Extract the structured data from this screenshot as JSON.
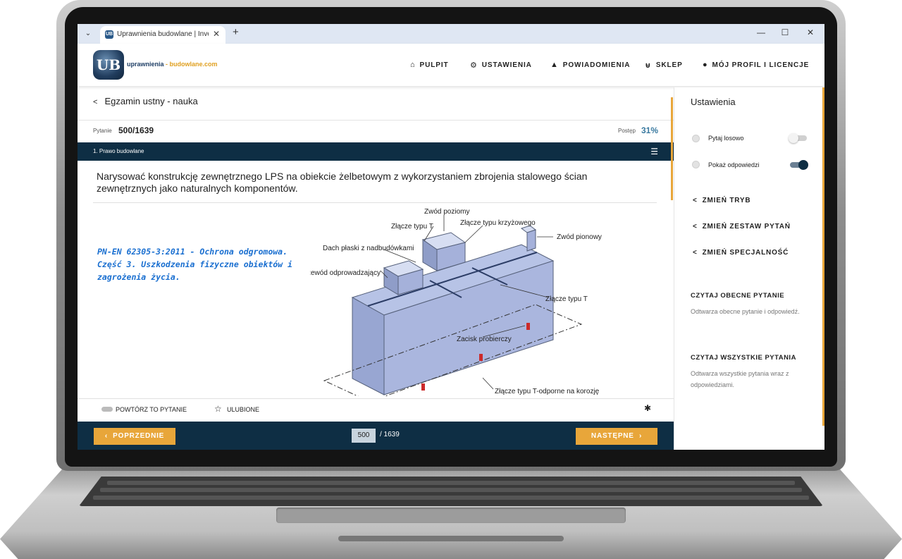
{
  "browser": {
    "tab_title": "Uprawnienia budowlane | Inve",
    "favicon_text": "UB",
    "tab_close": "✕",
    "new_tab": "+",
    "minimize": "—",
    "maximize": "☐",
    "close": "✕"
  },
  "header": {
    "logo_badge": "UB",
    "logo_text_a": "uprawnienia",
    "logo_text_b": " - budowlane.com",
    "nav": [
      {
        "label": "PULPIT",
        "icon": "home-icon"
      },
      {
        "label": "USTAWIENIA",
        "icon": "gears-icon"
      },
      {
        "label": "POWIADOMIENIA",
        "icon": "bell-icon"
      },
      {
        "label": "SKLEP",
        "icon": "basket-icon"
      },
      {
        "label": "MÓJ PROFIL I LICENCJE",
        "icon": "user-icon"
      }
    ]
  },
  "main": {
    "breadcrumb": "Egzamin ustny - nauka",
    "question_label": "Pytanie",
    "question_counter": "500/1639",
    "progress_label": "Postęp",
    "progress_value": "31%",
    "category": "1. Prawo budowlane",
    "question_text": "Narysować konstrukcję zewnętrznego LPS na obiekcie żelbetowym z wykorzystaniem zbrojenia stalowego ścian zewnętrznych jako naturalnych komponentów.",
    "reference_note": "PN-EN 62305-3:2011 - Ochrona odgromowa. Część 3. Uszkodzenia fizyczne obiektów i zagrożenia życia.",
    "diagram_labels": {
      "horizontal_conductor": "Zwód poziomy",
      "t_joint_top": "Złącze typu T",
      "cross_joint": "Złącze typu krzyżowego",
      "vertical_conductor": "Zwód pionowy",
      "flat_roof": "Dach płaski z nadbudówkami",
      "down_conductor": "Przewód odprowadzający",
      "t_joint_right": "Złącze typu T",
      "test_clamp": "Zacisk probierczy",
      "t_joint_corrosion": "Złącze typu T-odporne na korozję"
    },
    "repeat_label": "POWTÓRZ TO PYTANIE",
    "favorite_label": "ULUBIONE",
    "prev_label": "POPRZEDNIE",
    "next_label": "NASTĘPNE",
    "page_current": "500",
    "page_total": "/ 1639"
  },
  "sidebar": {
    "title": "Ustawienia",
    "random_label": "Pytaj losowo",
    "random_on": false,
    "answers_label": "Pokaż odpowiedzi",
    "answers_on": true,
    "links": [
      "ZMIEŃ TRYB",
      "ZMIEŃ ZESTAW PYTAŃ",
      "ZMIEŃ SPECJALNOŚĆ"
    ],
    "read_current_title": "CZYTAJ OBECNE PYTANIE",
    "read_current_desc": "Odtwarza obecne pytanie i odpowiedź.",
    "read_all_title": "CZYTAJ WSZYSTKIE PYTANIA",
    "read_all_desc": "Odtwarza wszystkie pytania wraz z odpowiedziami."
  },
  "colors": {
    "navy": "#0e2e44",
    "accent_orange": "#e8a63a",
    "progress_blue": "#3a7aa0",
    "note_blue": "#1a6fd0"
  }
}
